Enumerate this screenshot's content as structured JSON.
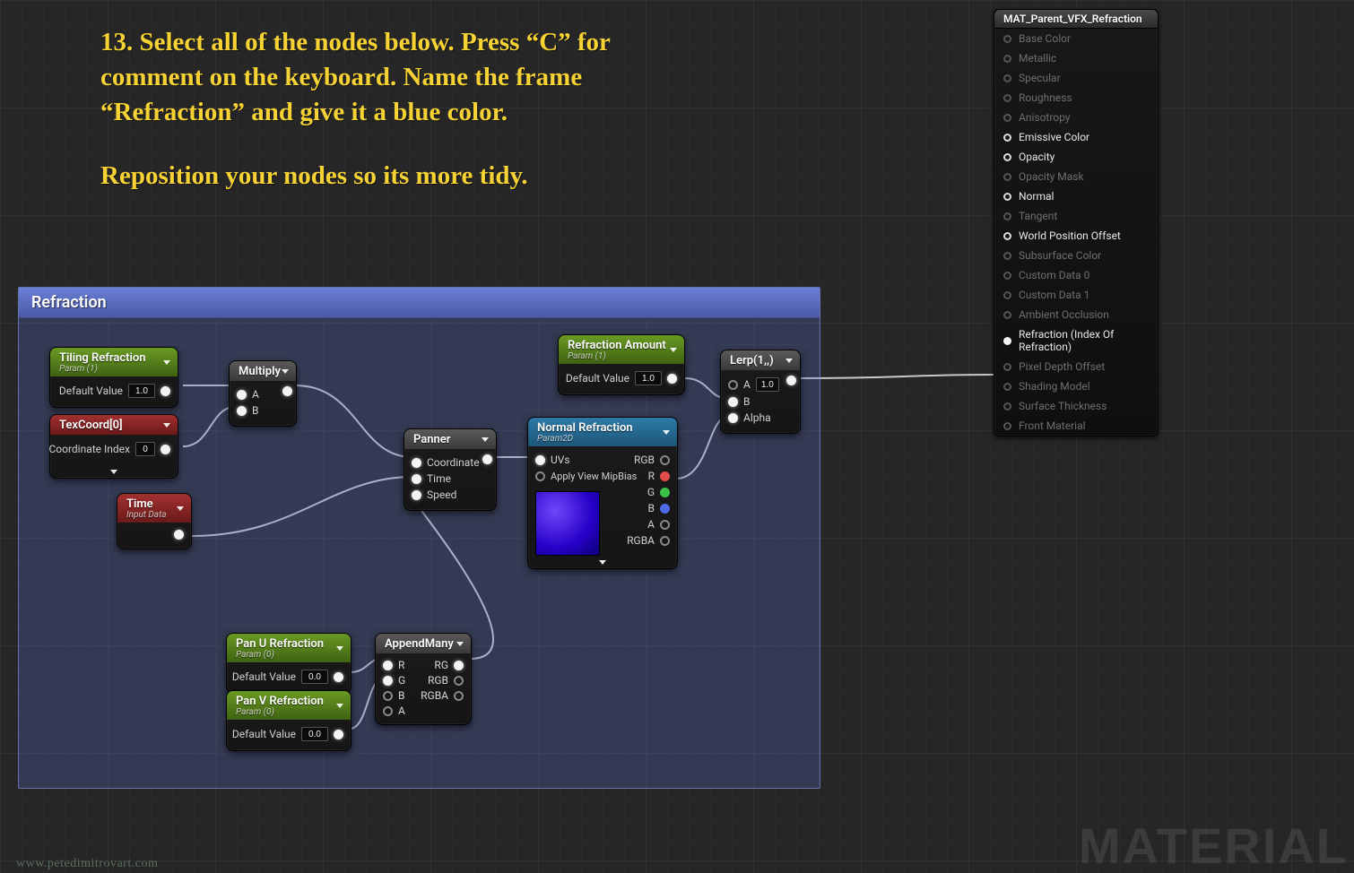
{
  "instructions": {
    "p1": "13. Select all of the nodes below. Press “C” for comment on the keyboard. Name the frame “Refraction” and give it a blue color.",
    "p2": "Reposition your nodes so its more tidy."
  },
  "comment": {
    "title": "Refraction"
  },
  "watermark_right": "MATERIAL",
  "watermark_left": "www.petedimitrovart.com",
  "nodes": {
    "tiling_refraction": {
      "title": "Tiling Refraction",
      "subtitle": "Param (1)",
      "default_label": "Default Value",
      "default_value": "1.0"
    },
    "texcoord": {
      "title": "TexCoord[0]",
      "idx_label": "Coordinate Index",
      "idx_value": "0"
    },
    "multiply": {
      "title": "Multiply",
      "pinA": "A",
      "pinB": "B"
    },
    "time": {
      "title": "Time",
      "subtitle": "Input Data"
    },
    "panner": {
      "title": "Panner",
      "coord": "Coordinate",
      "time": "Time",
      "speed": "Speed"
    },
    "pan_u": {
      "title": "Pan U Refraction",
      "subtitle": "Param (0)",
      "default_label": "Default Value",
      "default_value": "0.0"
    },
    "pan_v": {
      "title": "Pan V Refraction",
      "subtitle": "Param (0)",
      "default_label": "Default Value",
      "default_value": "0.0"
    },
    "append": {
      "title": "AppendMany",
      "R": "R",
      "G": "G",
      "B": "B",
      "A": "A",
      "RG": "RG",
      "RGB": "RGB",
      "RGBA": "RGBA"
    },
    "normal_refraction": {
      "title": "Normal Refraction",
      "subtitle": "Param2D",
      "uvs": "UVs",
      "mip": "Apply View MipBias",
      "rgb": "RGB",
      "r": "R",
      "g": "G",
      "b": "B",
      "a": "A",
      "rgba": "RGBA"
    },
    "refraction_amount": {
      "title": "Refraction Amount",
      "subtitle": "Param (1)",
      "default_label": "Default Value",
      "default_value": "1.0"
    },
    "lerp": {
      "title": "Lerp(1,,)",
      "A": "A",
      "B": "B",
      "Alpha": "Alpha",
      "Aval": "1.0"
    }
  },
  "material_panel": {
    "title": "MAT_Parent_VFX_Refraction",
    "rows": [
      {
        "label": "Base Color",
        "active": false
      },
      {
        "label": "Metallic",
        "active": false
      },
      {
        "label": "Specular",
        "active": false
      },
      {
        "label": "Roughness",
        "active": false
      },
      {
        "label": "Anisotropy",
        "active": false
      },
      {
        "label": "Emissive Color",
        "active": true
      },
      {
        "label": "Opacity",
        "active": true
      },
      {
        "label": "Opacity Mask",
        "active": false
      },
      {
        "label": "Normal",
        "active": true
      },
      {
        "label": "Tangent",
        "active": false
      },
      {
        "label": "World Position Offset",
        "active": true
      },
      {
        "label": "Subsurface Color",
        "active": false
      },
      {
        "label": "Custom Data 0",
        "active": false
      },
      {
        "label": "Custom Data 1",
        "active": false
      },
      {
        "label": "Ambient Occlusion",
        "active": false
      },
      {
        "label": "Refraction (Index Of Refraction)",
        "active": true,
        "filled": true
      },
      {
        "label": "Pixel Depth Offset",
        "active": false
      },
      {
        "label": "Shading Model",
        "active": false
      },
      {
        "label": "Surface Thickness",
        "active": false
      },
      {
        "label": "Front Material",
        "active": false
      }
    ]
  },
  "chart_data": null
}
